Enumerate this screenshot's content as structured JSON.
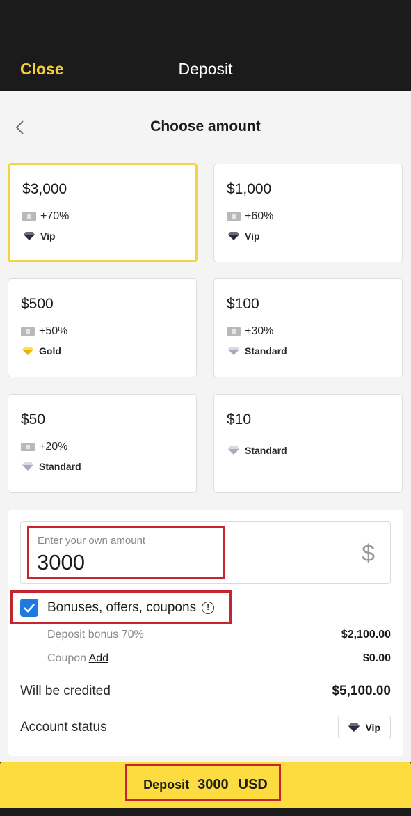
{
  "header": {
    "close_label": "Close",
    "title": "Deposit"
  },
  "screen": {
    "subtitle": "Choose amount"
  },
  "cards": [
    {
      "amount": "$3,000",
      "bonus": "+70%",
      "level": "Vip",
      "gem": "vip",
      "selected": true
    },
    {
      "amount": "$1,000",
      "bonus": "+60%",
      "level": "Vip",
      "gem": "vip",
      "selected": false
    },
    {
      "amount": "$500",
      "bonus": "+50%",
      "level": "Gold",
      "gem": "gold",
      "selected": false
    },
    {
      "amount": "$100",
      "bonus": "+30%",
      "level": "Standard",
      "gem": "standard",
      "selected": false
    },
    {
      "amount": "$50",
      "bonus": "+20%",
      "level": "Standard",
      "gem": "standard",
      "selected": false
    },
    {
      "amount": "$10",
      "bonus": "",
      "level": "Standard",
      "gem": "standard",
      "selected": false
    }
  ],
  "form": {
    "amount_placeholder": "Enter your own amount",
    "amount_value": "3000",
    "currency_symbol": "$",
    "bonuses_label": "Bonuses, offers, coupons",
    "bonuses_checked": true,
    "info_icon_glyph": "!",
    "deposit_bonus_label": "Deposit bonus 70%",
    "deposit_bonus_value": "$2,100.00",
    "coupon_label": "Coupon",
    "coupon_link": "Add",
    "coupon_value": "$0.00",
    "credited_label": "Will be credited",
    "credited_value": "$5,100.00",
    "status_label": "Account status",
    "status_value": "Vip"
  },
  "deposit_button": {
    "label": "Deposit",
    "amount": "3000",
    "currency": "USD"
  },
  "colors": {
    "accent_yellow": "#fcdc3f",
    "close_yellow": "#f5cf38",
    "selected_border": "#f4d440",
    "checkbox_blue": "#1f7ae0",
    "highlight_red": "#c4252e"
  },
  "icons": {
    "back": "chevron-left-icon",
    "ticket": "ticket-icon",
    "gem": "diamond-icon",
    "check": "checkmark-icon",
    "info": "info-icon"
  }
}
